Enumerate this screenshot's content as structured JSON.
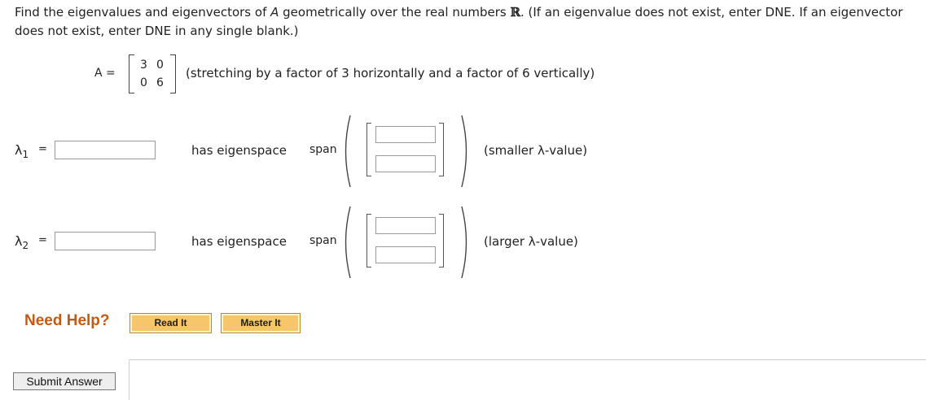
{
  "prompt": {
    "part1": "Find the eigenvalues and eigenvectors of ",
    "var_A": "A",
    "part2": " geometrically over the real numbers ",
    "reals": "ℝ",
    "part3": ". (If an eigenvalue does not exist, enter DNE. If an eigenvector does not exist, enter DNE in any single blank.)"
  },
  "matrix": {
    "label": "A =",
    "cells": [
      "3",
      "0",
      "0",
      "6"
    ],
    "description": "(stretching by a factor of 3 horizontally and a factor of 6 vertically)"
  },
  "rows": [
    {
      "lambda_symbol": "λ",
      "subscript": "1",
      "equals": "=",
      "value": "",
      "eigenspace_label": "has eigenspace",
      "span_label": "span",
      "vector": [
        "",
        ""
      ],
      "note": "(smaller λ-value)"
    },
    {
      "lambda_symbol": "λ",
      "subscript": "2",
      "equals": "=",
      "value": "",
      "eigenspace_label": "has eigenspace",
      "span_label": "span",
      "vector": [
        "",
        ""
      ],
      "note": "(larger λ-value)"
    }
  ],
  "help": {
    "label": "Need Help?",
    "read_it": "Read It",
    "master_it": "Master It"
  },
  "submit_label": "Submit Answer"
}
